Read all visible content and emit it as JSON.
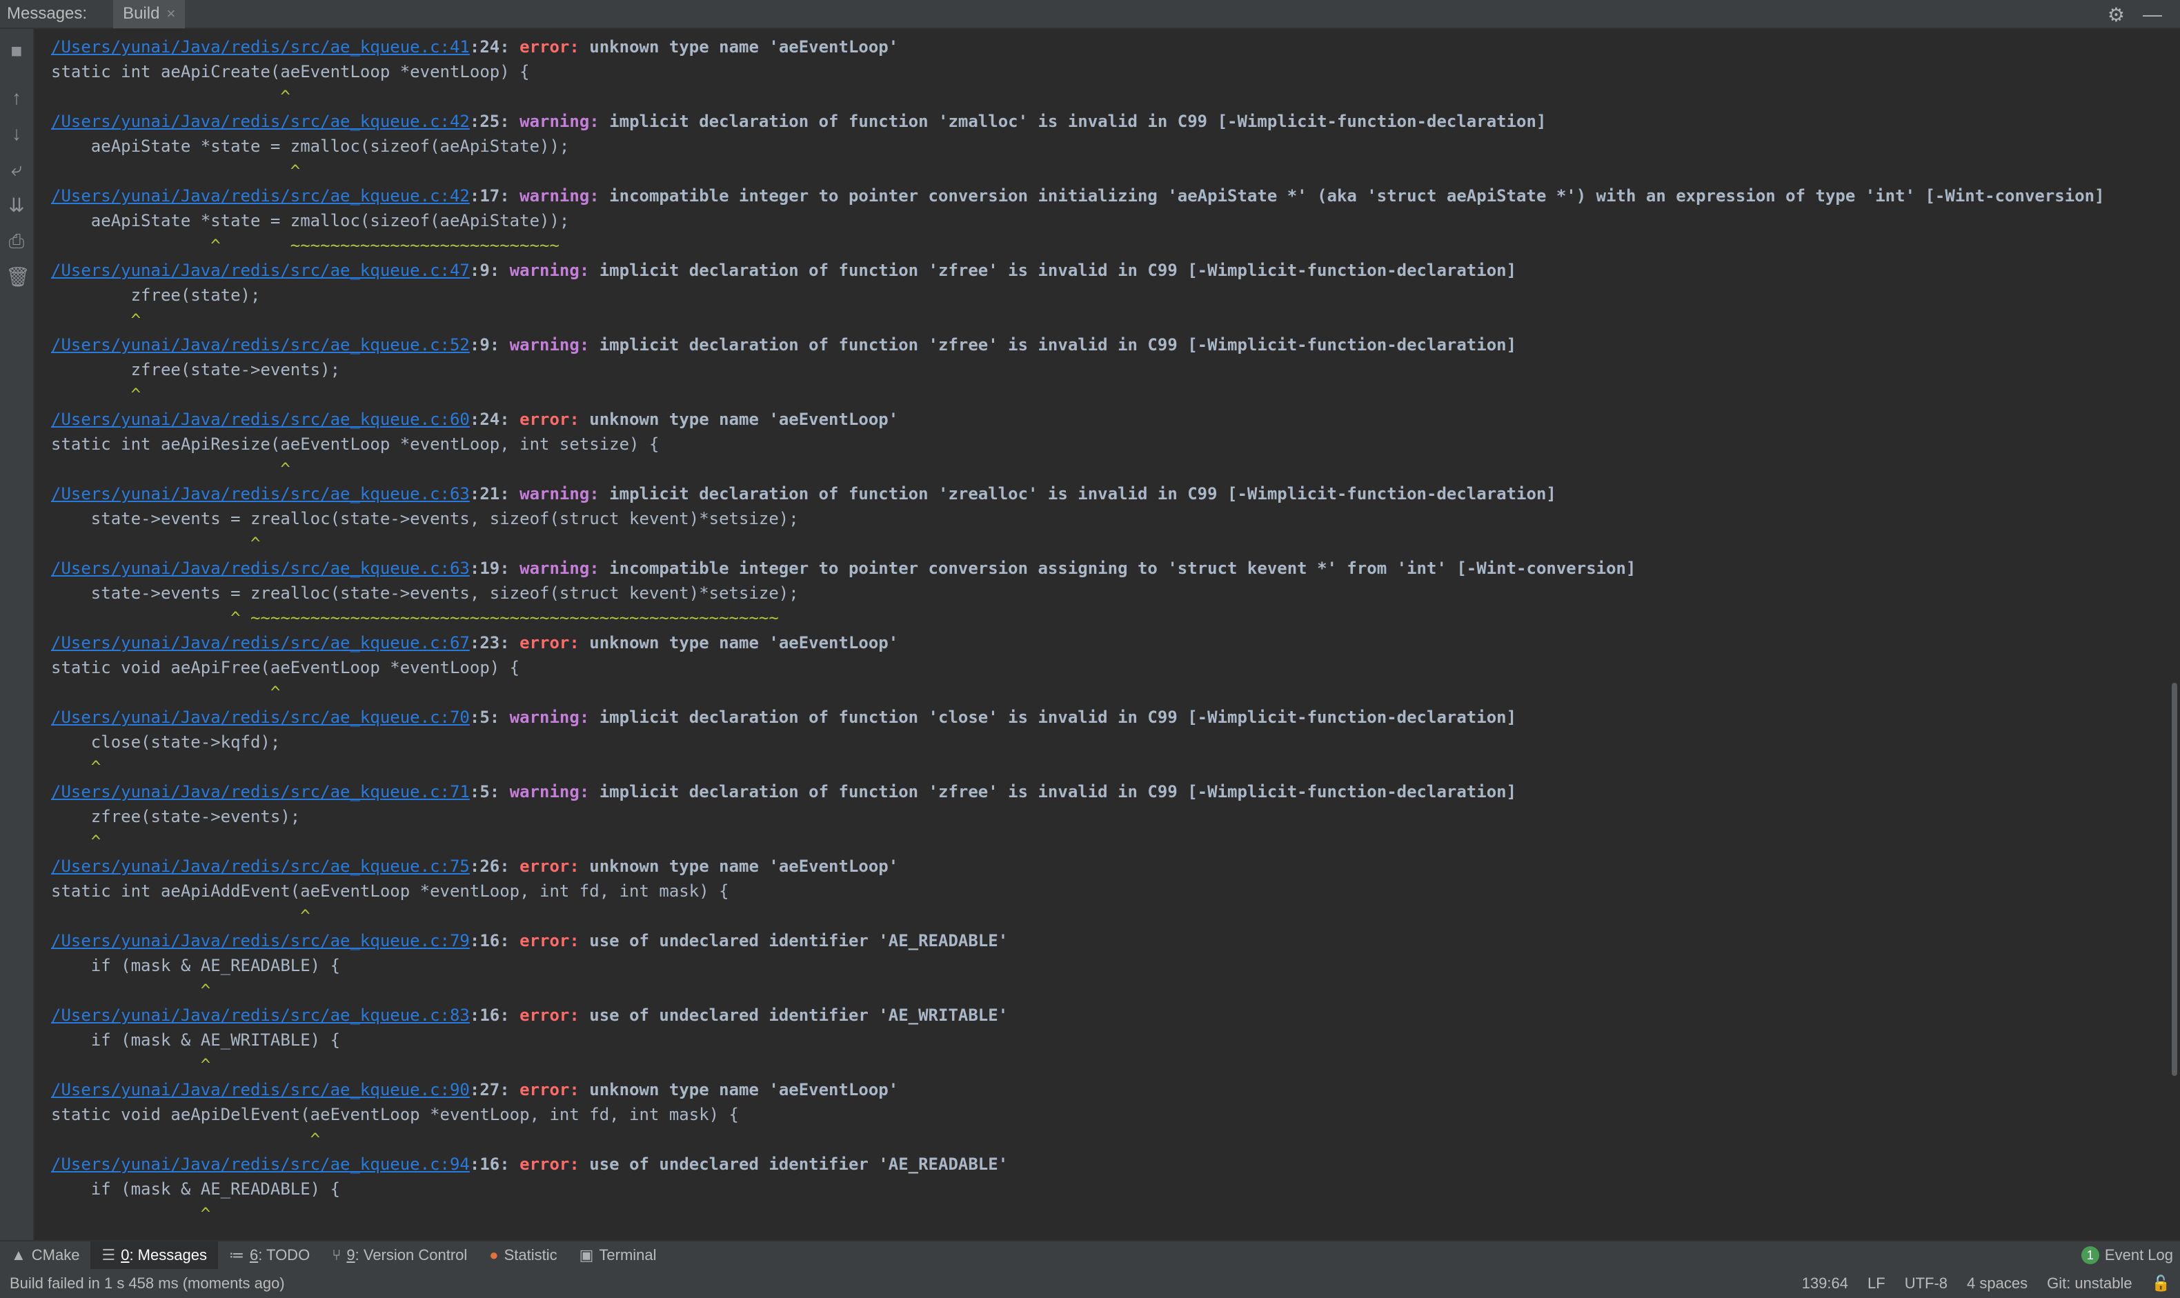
{
  "header": {
    "title": "Messages:",
    "tab_label": "Build",
    "tab_close": "×",
    "settings_icon": "⚙",
    "minimize_icon": "—"
  },
  "toolbar_icons": [
    "stop-icon",
    "up-icon",
    "down-icon",
    "soft-wrap-icon",
    "scroll-end-icon",
    "print-icon",
    "trash-icon"
  ],
  "console": {
    "lines": [
      {
        "type": "msg",
        "loc": "/Users/yunai/Java/redis/src/ae_kqueue.c:41",
        "pos": ":24: ",
        "kind": "error",
        "kindLabel": "error:",
        "text": " unknown type name 'aeEventLoop'"
      },
      {
        "type": "code",
        "text": "static int aeApiCreate(aeEventLoop *eventLoop) {"
      },
      {
        "type": "caret",
        "text": "                       ^"
      },
      {
        "type": "msg",
        "loc": "/Users/yunai/Java/redis/src/ae_kqueue.c:42",
        "pos": ":25: ",
        "kind": "warning",
        "kindLabel": "warning:",
        "text": " implicit declaration of function 'zmalloc' is invalid in C99 [-Wimplicit-function-declaration]"
      },
      {
        "type": "code",
        "text": "    aeApiState *state = zmalloc(sizeof(aeApiState));"
      },
      {
        "type": "caret",
        "text": "                        ^"
      },
      {
        "type": "msg",
        "loc": "/Users/yunai/Java/redis/src/ae_kqueue.c:42",
        "pos": ":17: ",
        "kind": "warning",
        "kindLabel": "warning:",
        "text": " incompatible integer to pointer conversion initializing 'aeApiState *' (aka 'struct aeApiState *') with an expression of type 'int' [-Wint-conversion]"
      },
      {
        "type": "code",
        "text": "    aeApiState *state = zmalloc(sizeof(aeApiState));"
      },
      {
        "type": "caret",
        "text": "                ^       ~~~~~~~~~~~~~~~~~~~~~~~~~~~"
      },
      {
        "type": "msg",
        "loc": "/Users/yunai/Java/redis/src/ae_kqueue.c:47",
        "pos": ":9: ",
        "kind": "warning",
        "kindLabel": "warning:",
        "text": " implicit declaration of function 'zfree' is invalid in C99 [-Wimplicit-function-declaration]"
      },
      {
        "type": "code",
        "text": "        zfree(state);"
      },
      {
        "type": "caret",
        "text": "        ^"
      },
      {
        "type": "msg",
        "loc": "/Users/yunai/Java/redis/src/ae_kqueue.c:52",
        "pos": ":9: ",
        "kind": "warning",
        "kindLabel": "warning:",
        "text": " implicit declaration of function 'zfree' is invalid in C99 [-Wimplicit-function-declaration]"
      },
      {
        "type": "code",
        "text": "        zfree(state->events);"
      },
      {
        "type": "caret",
        "text": "        ^"
      },
      {
        "type": "msg",
        "loc": "/Users/yunai/Java/redis/src/ae_kqueue.c:60",
        "pos": ":24: ",
        "kind": "error",
        "kindLabel": "error:",
        "text": " unknown type name 'aeEventLoop'"
      },
      {
        "type": "code",
        "text": "static int aeApiResize(aeEventLoop *eventLoop, int setsize) {"
      },
      {
        "type": "caret",
        "text": "                       ^"
      },
      {
        "type": "msg",
        "loc": "/Users/yunai/Java/redis/src/ae_kqueue.c:63",
        "pos": ":21: ",
        "kind": "warning",
        "kindLabel": "warning:",
        "text": " implicit declaration of function 'zrealloc' is invalid in C99 [-Wimplicit-function-declaration]"
      },
      {
        "type": "code",
        "text": "    state->events = zrealloc(state->events, sizeof(struct kevent)*setsize);"
      },
      {
        "type": "caret",
        "text": "                    ^"
      },
      {
        "type": "msg",
        "loc": "/Users/yunai/Java/redis/src/ae_kqueue.c:63",
        "pos": ":19: ",
        "kind": "warning",
        "kindLabel": "warning:",
        "text": " incompatible integer to pointer conversion assigning to 'struct kevent *' from 'int' [-Wint-conversion]"
      },
      {
        "type": "code",
        "text": "    state->events = zrealloc(state->events, sizeof(struct kevent)*setsize);"
      },
      {
        "type": "caret",
        "text": "                  ^ ~~~~~~~~~~~~~~~~~~~~~~~~~~~~~~~~~~~~~~~~~~~~~~~~~~~~~"
      },
      {
        "type": "msg",
        "loc": "/Users/yunai/Java/redis/src/ae_kqueue.c:67",
        "pos": ":23: ",
        "kind": "error",
        "kindLabel": "error:",
        "text": " unknown type name 'aeEventLoop'"
      },
      {
        "type": "code",
        "text": "static void aeApiFree(aeEventLoop *eventLoop) {"
      },
      {
        "type": "caret",
        "text": "                      ^"
      },
      {
        "type": "msg",
        "loc": "/Users/yunai/Java/redis/src/ae_kqueue.c:70",
        "pos": ":5: ",
        "kind": "warning",
        "kindLabel": "warning:",
        "text": " implicit declaration of function 'close' is invalid in C99 [-Wimplicit-function-declaration]"
      },
      {
        "type": "code",
        "text": "    close(state->kqfd);"
      },
      {
        "type": "caret",
        "text": "    ^"
      },
      {
        "type": "msg",
        "loc": "/Users/yunai/Java/redis/src/ae_kqueue.c:71",
        "pos": ":5: ",
        "kind": "warning",
        "kindLabel": "warning:",
        "text": " implicit declaration of function 'zfree' is invalid in C99 [-Wimplicit-function-declaration]"
      },
      {
        "type": "code",
        "text": "    zfree(state->events);"
      },
      {
        "type": "caret",
        "text": "    ^"
      },
      {
        "type": "msg",
        "loc": "/Users/yunai/Java/redis/src/ae_kqueue.c:75",
        "pos": ":26: ",
        "kind": "error",
        "kindLabel": "error:",
        "text": " unknown type name 'aeEventLoop'"
      },
      {
        "type": "code",
        "text": "static int aeApiAddEvent(aeEventLoop *eventLoop, int fd, int mask) {"
      },
      {
        "type": "caret",
        "text": "                         ^"
      },
      {
        "type": "msg",
        "loc": "/Users/yunai/Java/redis/src/ae_kqueue.c:79",
        "pos": ":16: ",
        "kind": "error",
        "kindLabel": "error:",
        "text": " use of undeclared identifier 'AE_READABLE'"
      },
      {
        "type": "code",
        "text": "    if (mask & AE_READABLE) {"
      },
      {
        "type": "caret",
        "text": "               ^"
      },
      {
        "type": "msg",
        "loc": "/Users/yunai/Java/redis/src/ae_kqueue.c:83",
        "pos": ":16: ",
        "kind": "error",
        "kindLabel": "error:",
        "text": " use of undeclared identifier 'AE_WRITABLE'"
      },
      {
        "type": "code",
        "text": "    if (mask & AE_WRITABLE) {"
      },
      {
        "type": "caret",
        "text": "               ^"
      },
      {
        "type": "msg",
        "loc": "/Users/yunai/Java/redis/src/ae_kqueue.c:90",
        "pos": ":27: ",
        "kind": "error",
        "kindLabel": "error:",
        "text": " unknown type name 'aeEventLoop'"
      },
      {
        "type": "code",
        "text": "static void aeApiDelEvent(aeEventLoop *eventLoop, int fd, int mask) {"
      },
      {
        "type": "caret",
        "text": "                          ^"
      },
      {
        "type": "msg",
        "loc": "/Users/yunai/Java/redis/src/ae_kqueue.c:94",
        "pos": ":16: ",
        "kind": "error",
        "kindLabel": "error:",
        "text": " use of undeclared identifier 'AE_READABLE'"
      },
      {
        "type": "code",
        "text": "    if (mask & AE_READABLE) {"
      },
      {
        "type": "caret",
        "text": "               ^"
      }
    ]
  },
  "bottom_tabs": [
    {
      "icon": "▲",
      "label": "CMake",
      "num": ""
    },
    {
      "icon": "☰",
      "label": ": Messages",
      "num": "0"
    },
    {
      "icon": "≔",
      "label": ": TODO",
      "num": "6"
    },
    {
      "icon": "⑂",
      "label": ": Version Control",
      "num": "9"
    },
    {
      "icon": "●",
      "label": "Statistic",
      "num": ""
    },
    {
      "icon": "▣",
      "label": "Terminal",
      "num": ""
    }
  ],
  "event_log": {
    "badge": "1",
    "label": "Event Log"
  },
  "status": {
    "message": "Build failed in 1 s 458 ms (moments ago)",
    "position": "139:64",
    "line_sep": "LF",
    "encoding": "UTF-8",
    "indent": "4 spaces",
    "git": "Git: unstable"
  },
  "colors": {
    "error": "#ff6b68",
    "warning": "#c57fdb",
    "link": "#287bde",
    "caret": "#b0c43b"
  }
}
